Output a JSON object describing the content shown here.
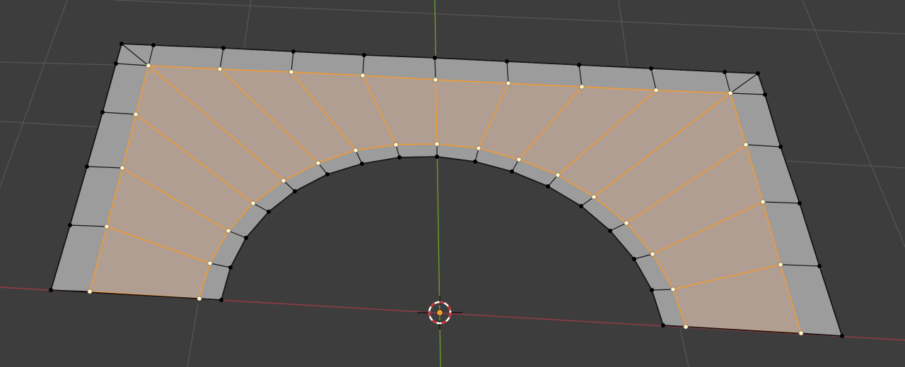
{
  "viewport": {
    "mode": "edit-mode",
    "selection": "inset-faces",
    "colors": {
      "background": "#3d3d3d",
      "grid": "#555555",
      "x_axis": "#9a3a48",
      "y_axis": "#6f9a2a",
      "face": "#9c9c9c",
      "selected_face": "#b09e93",
      "edge": "#151515",
      "selected_edge": "#f39a2e",
      "vertex": "#000000",
      "selected_vertex": "#fff5cf",
      "cursor_ring_red": "#d83030",
      "cursor_ring_white": "#ffffff",
      "origin": "#f39a2e"
    },
    "icons": [
      "3d-cursor-icon",
      "origin-point-icon"
    ]
  }
}
